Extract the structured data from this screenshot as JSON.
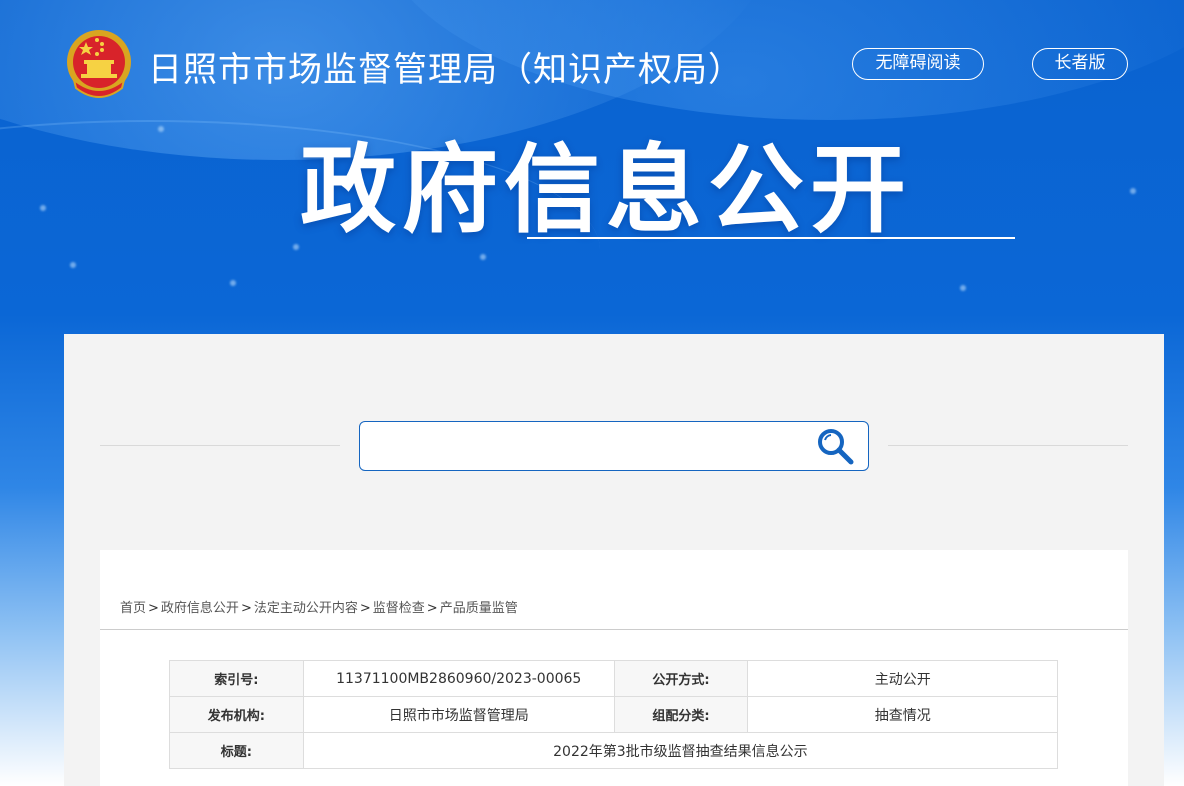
{
  "header": {
    "site_title": "日照市市场监督管理局（知识产权局）",
    "accessible_btn": "无障碍阅读",
    "elderly_btn": "长者版",
    "main_title": "政府信息公开"
  },
  "search": {
    "placeholder": ""
  },
  "breadcrumb": {
    "items": [
      "首页",
      "政府信息公开",
      "法定主动公开内容",
      "监督检查",
      "产品质量监管"
    ],
    "separator": ">"
  },
  "info_table": {
    "index_label": "索引号:",
    "index_value": "11371100MB2860960/2023-00065",
    "method_label": "公开方式:",
    "method_value": "主动公开",
    "publisher_label": "发布机构:",
    "publisher_value": "日照市市场监督管理局",
    "category_label": "组配分类:",
    "category_value": "抽查情况",
    "title_label": "标题:",
    "title_value": "2022年第3批市级监督抽查结果信息公示"
  },
  "colors": {
    "banner_blue": "#0a62cf",
    "accent_blue": "#1565c0",
    "panel_gray": "#f3f3f3"
  }
}
